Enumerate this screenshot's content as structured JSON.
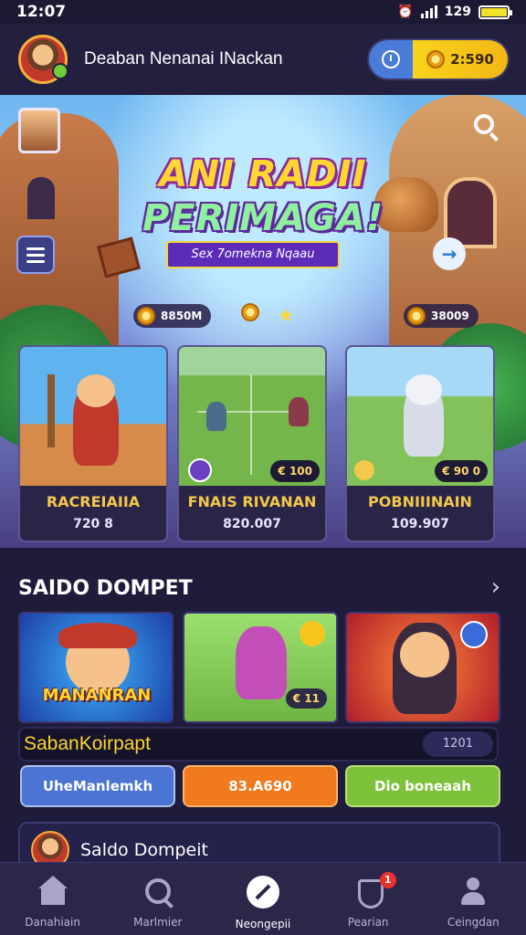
{
  "status_bar": {
    "time": "12:07",
    "signal_text": "129"
  },
  "header": {
    "title": "Deaban Nenanai INackan",
    "balance": "2:590"
  },
  "banner": {
    "title_line1": "ANI RADII",
    "title_line2": "PERIMAGA!",
    "subtitle": "Sex 7omekna Nqaau",
    "chip_left": "8850M",
    "chip_right": "38009"
  },
  "games": [
    {
      "name": "RACREIAIIA",
      "score": "720 8",
      "tag": ""
    },
    {
      "name": "FNAIS RIVANAN",
      "score": "820.007",
      "tag": "€ 100"
    },
    {
      "name": "POBNIIINAIN",
      "score": "109.907",
      "tag": "€ 90 0"
    }
  ],
  "section": {
    "title": "SAIDO DOMPET"
  },
  "tiles": {
    "t1_label": "MANANRAN",
    "t2_badge": "€ 11"
  },
  "saldo_bar": {
    "label": "SabanKoirpapt",
    "value": "1201"
  },
  "buttons": [
    "UheManlemkh",
    "83.A690",
    "Dio boneaah"
  ],
  "saldo_card": {
    "text": "Saldo Dompeit"
  },
  "bottom_nav": [
    {
      "label": "Danahiain",
      "icon": "home-icon"
    },
    {
      "label": "Marlmier",
      "icon": "search-icon"
    },
    {
      "label": "Neongepii",
      "icon": "center-action-icon"
    },
    {
      "label": "Pearian",
      "icon": "shield-icon",
      "badge": "1"
    },
    {
      "label": "Ceingdan",
      "icon": "user-icon"
    }
  ],
  "colors": {
    "accent_yellow": "#f6d31c",
    "blue": "#4b74d4",
    "orange": "#f07a1c",
    "green": "#7ec13a",
    "background": "#1f1c3b"
  }
}
